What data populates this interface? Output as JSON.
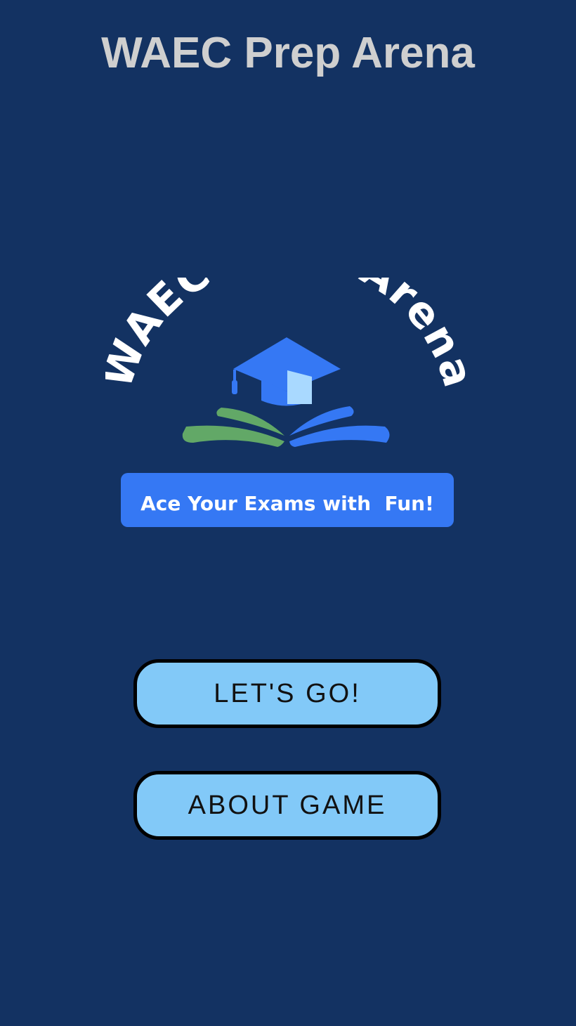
{
  "header": {
    "title": "WAEC Prep Arena"
  },
  "logo": {
    "arc_text": "WAEC Prep Arena",
    "tagline": "Ace Your Exams with  Fun!",
    "icon": "graduation-cap-book-icon",
    "colors": {
      "cap": "#3578f4",
      "cap_highlight": "#a9d9ff",
      "book_left": "#62a867",
      "book_right": "#3578f4",
      "tagline_bg": "#3578f4",
      "text": "#ffffff"
    }
  },
  "menu": {
    "start_label": "LET'S GO!",
    "about_label": "ABOUT GAME"
  },
  "colors": {
    "background": "#133262",
    "title": "#cfcfcf",
    "button_fill": "#82c9f8",
    "button_border": "#000000"
  }
}
